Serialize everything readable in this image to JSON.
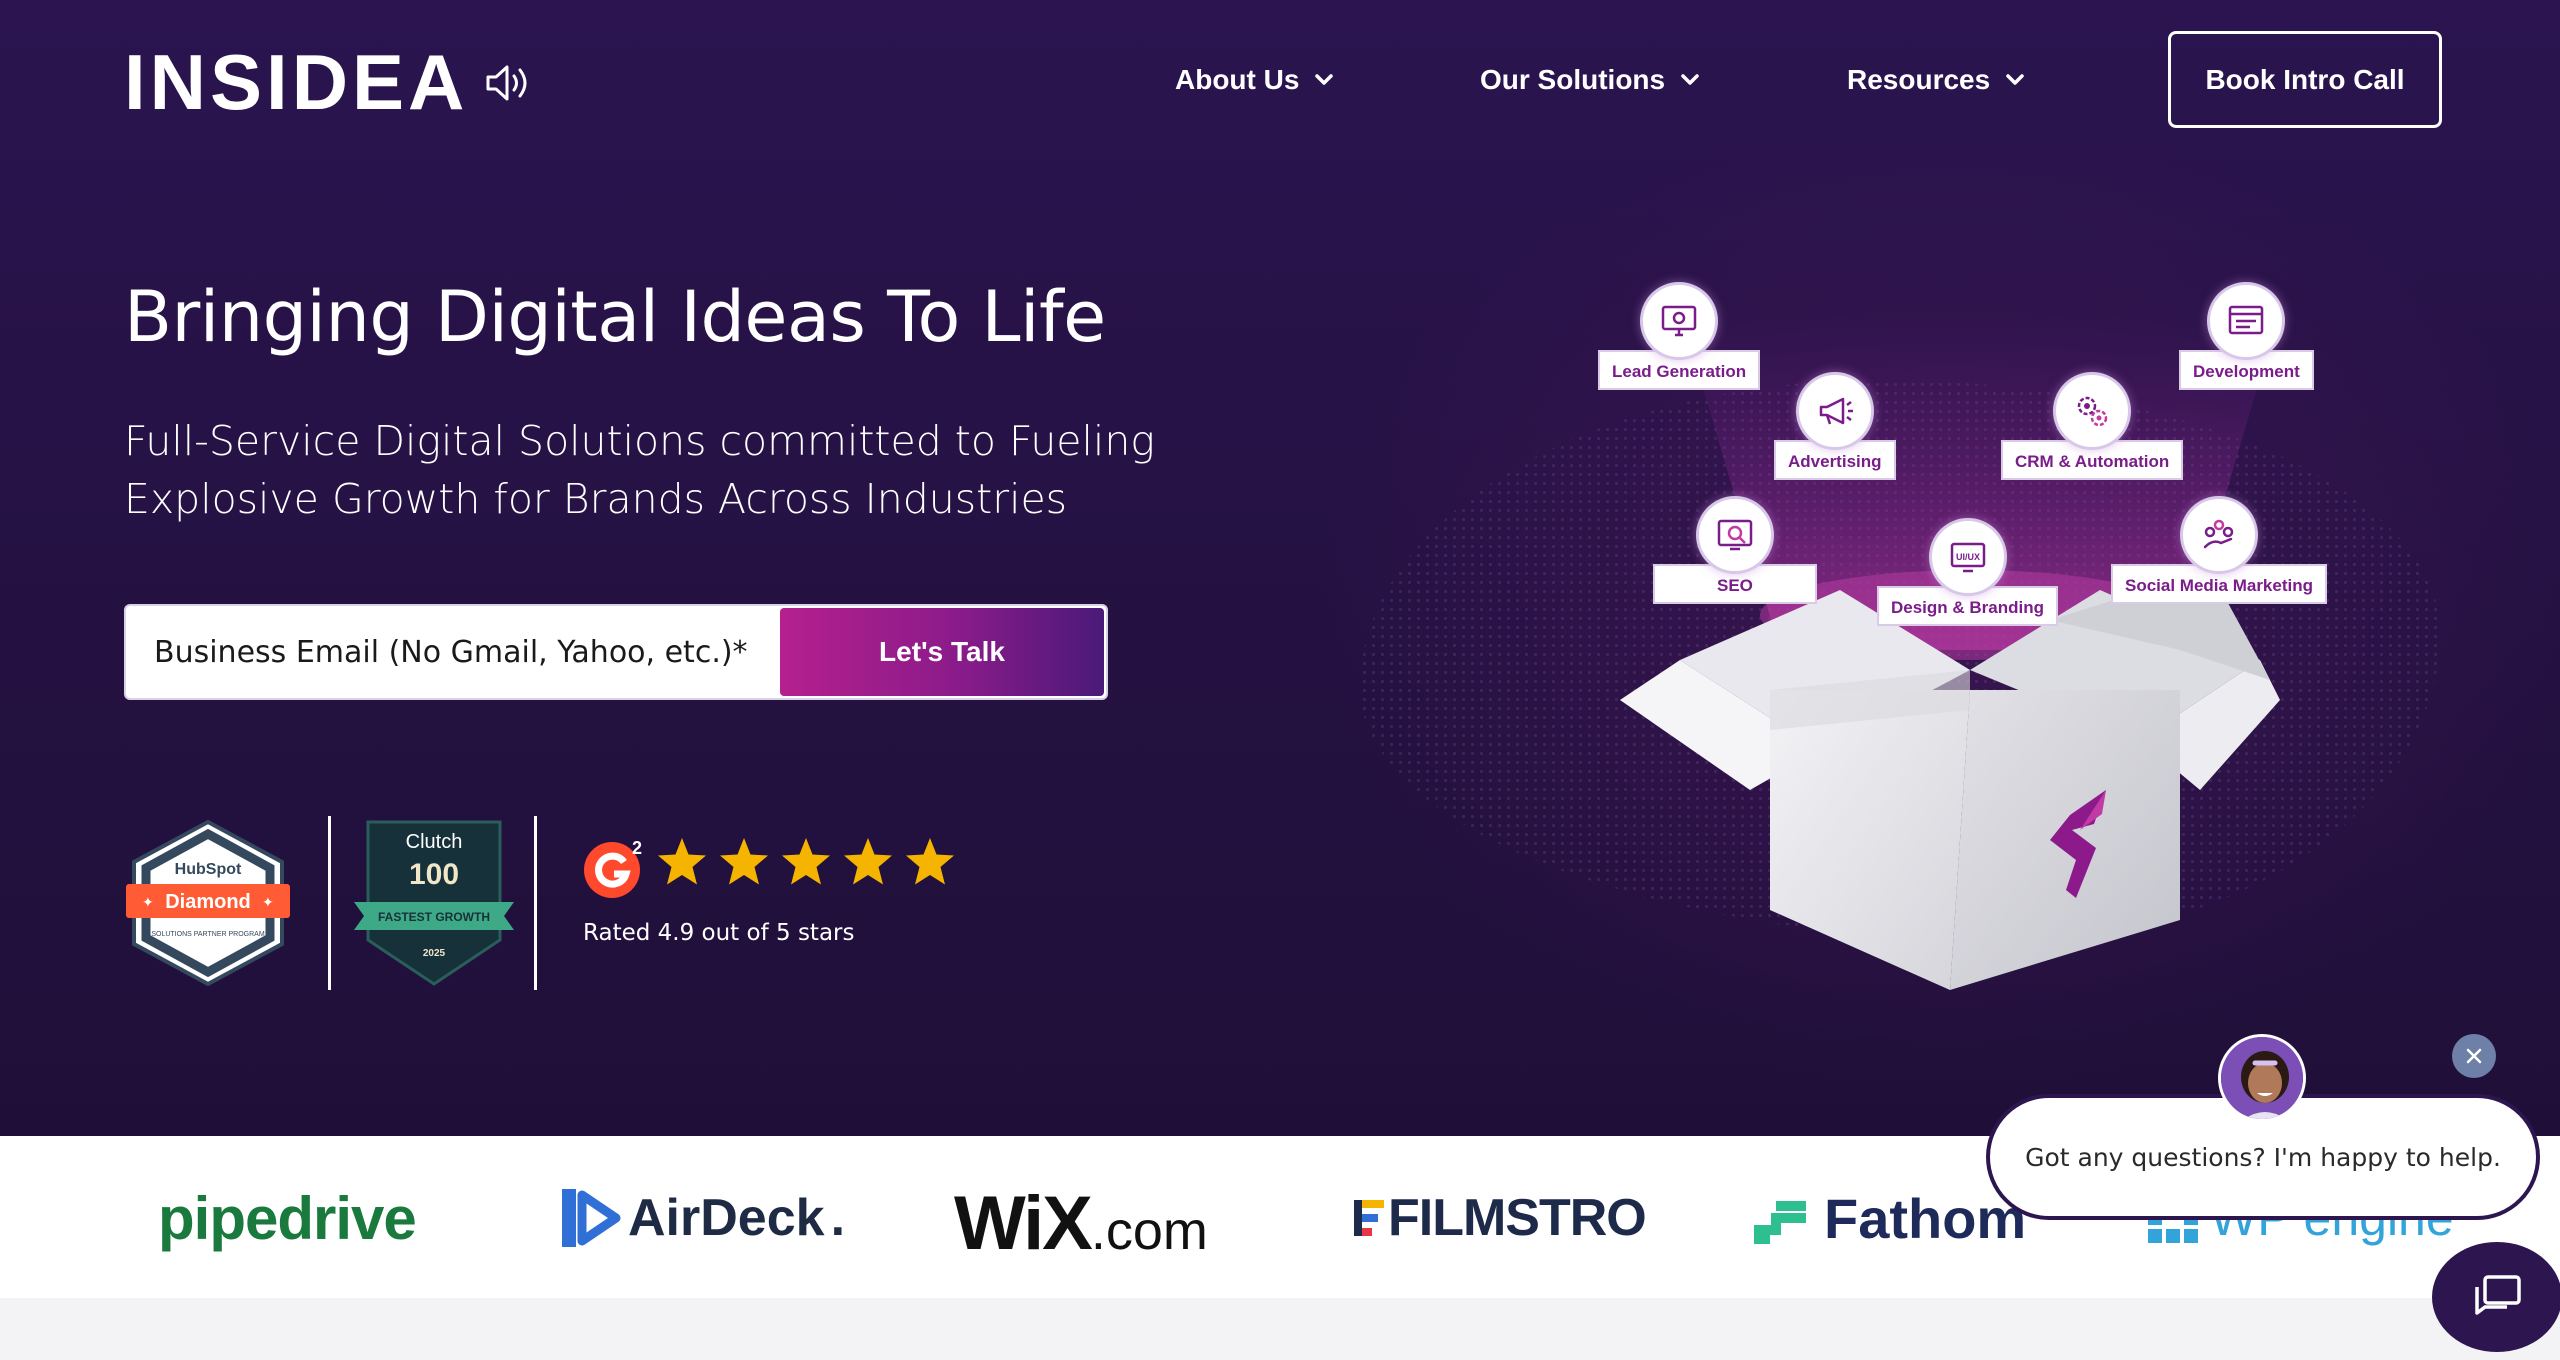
{
  "header": {
    "logo_text": "INSIDEA",
    "nav": [
      {
        "label": "About Us"
      },
      {
        "label": "Our Solutions"
      },
      {
        "label": "Resources"
      }
    ],
    "cta_label": "Book Intro Call"
  },
  "hero": {
    "title": "Bringing Digital Ideas To Life",
    "subtitle_line1": "Full-Service Digital Solutions committed to Fueling",
    "subtitle_line2": "Explosive Growth for Brands Across Industries",
    "email_placeholder": "Business Email (No Gmail, Yahoo, etc.)*",
    "submit_label": "Let's Talk"
  },
  "badges": {
    "hubspot_brand": "HubSpot",
    "hubspot_tier": "Diamond",
    "hubspot_program": "SOLUTIONS PARTNER PROGRAM",
    "clutch_brand": "Clutch",
    "clutch_number": "100",
    "clutch_ribbon": "FASTEST GROWTH",
    "clutch_year": "2025",
    "g2_rating_text": "Rated 4.9 out of 5 stars",
    "g2_stars": 5
  },
  "services": [
    {
      "label": "Lead Generation",
      "icon": "monitor-gear-icon"
    },
    {
      "label": "Development",
      "icon": "browser-window-icon"
    },
    {
      "label": "Advertising",
      "icon": "megaphone-icon"
    },
    {
      "label": "CRM & Automation",
      "icon": "gears-icon"
    },
    {
      "label": "SEO",
      "icon": "analytics-monitor-icon"
    },
    {
      "label": "Design & Branding",
      "icon": "ui-ux-monitor-icon"
    },
    {
      "label": "Social Media Marketing",
      "icon": "hand-network-icon"
    }
  ],
  "box_logo": "S",
  "partners": [
    {
      "name": "pipedrive",
      "color": "#1a7a3e"
    },
    {
      "name": "AirDeck",
      "suffix": ".",
      "color": "#1f2a44"
    },
    {
      "name": "WiX",
      "suffix": ".com",
      "color": "#111111"
    },
    {
      "name": "FILMSTRO",
      "color": "#1e2a4a"
    },
    {
      "name": "Fathom",
      "color": "#1e2a5a"
    },
    {
      "name": "WP engine",
      "color": "#1c9bd6"
    }
  ],
  "chat": {
    "message": "Got any questions? I'm happy to help."
  },
  "colors": {
    "hero_bg": "#261245",
    "accent_magenta": "#b5208e",
    "chat_navy": "#2d1650",
    "star_yellow": "#f5b400"
  }
}
